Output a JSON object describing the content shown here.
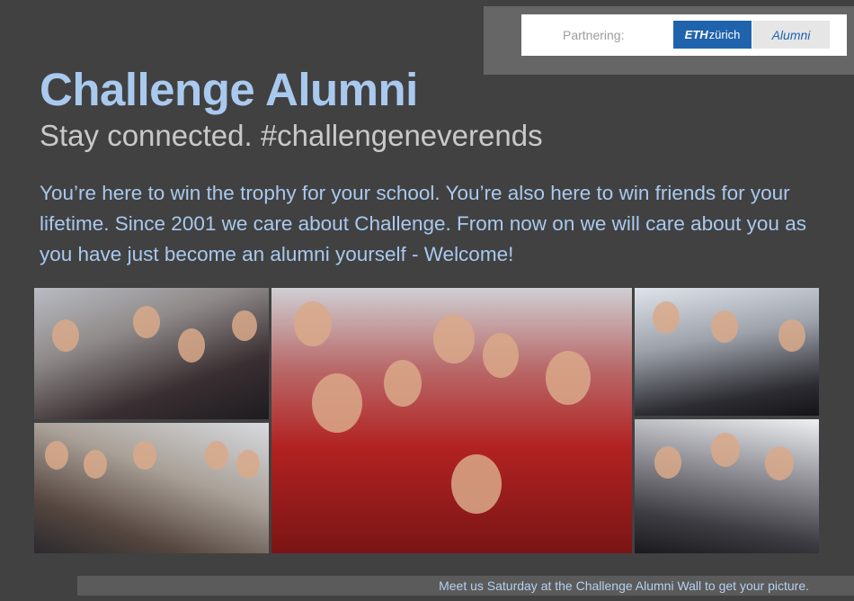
{
  "partner": {
    "label": "Partnering:",
    "eth_bold": "ETH",
    "eth_rest": "zürich",
    "alumni_tab": "Alumni"
  },
  "header": {
    "title": "Challenge Alumni",
    "subtitle": "Stay connected. #challengeneverends"
  },
  "intro": "You’re here to win the trophy for your school. You’re also here to win friends for your lifetime. Since 2001 we care about Challenge. From now on we will care about you as you have just become an alumni yourself - Welcome!",
  "footer": {
    "text": "Meet us Saturday at the Challenge Alumni Wall to get your picture."
  },
  "colors": {
    "background": "#414141",
    "accent_blue": "#a9c9ef",
    "eth_blue": "#1f63ad"
  }
}
